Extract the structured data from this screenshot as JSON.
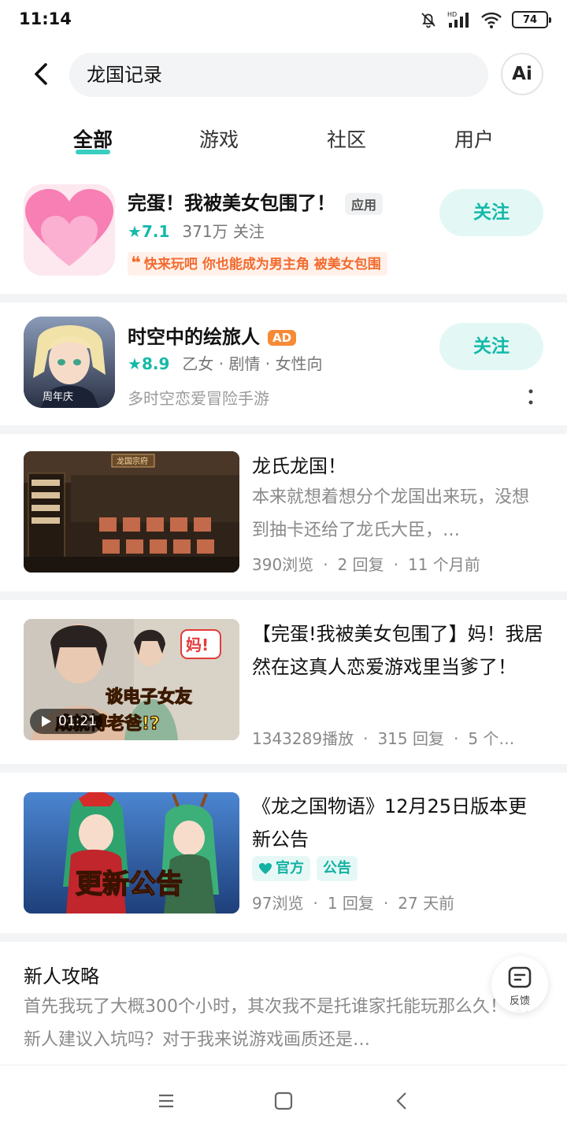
{
  "status_bar": {
    "time": "11:14",
    "battery": "74",
    "signal_label": "HD"
  },
  "search": {
    "query": "龙国记录",
    "ai_label": "Ai"
  },
  "tabs": [
    {
      "label": "全部",
      "active": true
    },
    {
      "label": "游戏",
      "active": false
    },
    {
      "label": "社区",
      "active": false
    },
    {
      "label": "用户",
      "active": false
    }
  ],
  "apps": [
    {
      "title": "完蛋！我被美女包围了！",
      "tag": "应用",
      "rating": "7.1",
      "meta": "371万 关注",
      "quote": "快来玩吧 你也能成为男主角 被美女包围",
      "button": "关注"
    },
    {
      "title": "时空中的绘旅人",
      "tag": "AD",
      "rating": "8.9",
      "meta": "乙女 · 剧情 · 女性向",
      "desc": "多时空恋爱冒险手游",
      "icon_text": "周年庆",
      "button": "关注"
    }
  ],
  "posts": [
    {
      "title": "龙氏龙国！",
      "body": "本来就想着想分个龙国出来玩，没想到抽卡还给了龙氏大臣，…",
      "views": "390浏览",
      "replies": "2 回复",
      "time": "11 个月前",
      "thumb_text": "龙国宗府"
    },
    {
      "title": "【完蛋!我被美女包围了】妈！我居然在这真人恋爱游戏里当爹了！",
      "views": "1343289播放",
      "replies": "315 回复",
      "time": "5 个…",
      "duration": "01:21",
      "overlay_1": "谈电子女友",
      "overlay_2": "成就博老爸!?",
      "sticker": "妈!"
    },
    {
      "title": "《龙之国物语》12月25日版本更新公告",
      "badge_official": "官方",
      "badge_notice": "公告",
      "views": "97浏览",
      "replies": "1 回复",
      "time": "27 天前",
      "thumb_text": "更新公告"
    }
  ],
  "guide": {
    "title": "新人攻略",
    "body": "首先我玩了大概300个小时，其次我不是托谁家托能玩那么久！ 1: 新人建议入坑吗？对于我来说游戏画质还是…"
  },
  "feedback_label": "反馈",
  "colors": {
    "accent": "#15c5b6",
    "follow_bg": "#e3f8f5",
    "quote": "#f26a2e",
    "ad": "#f78a36"
  }
}
